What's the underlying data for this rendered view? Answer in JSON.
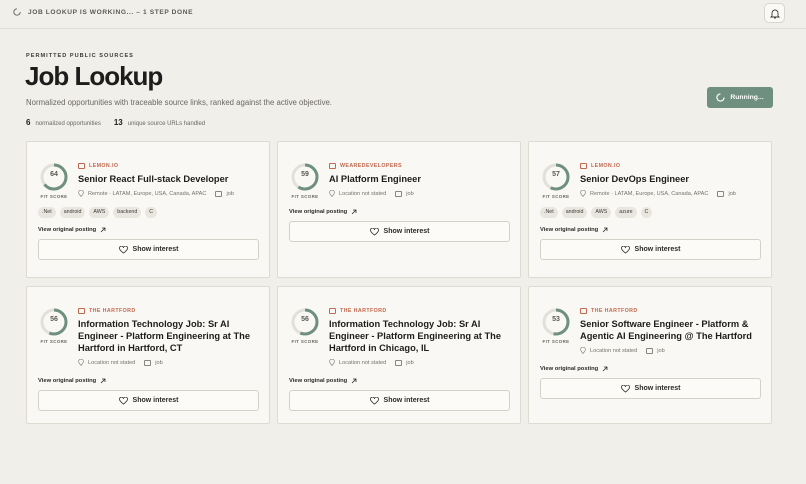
{
  "topbar": {
    "status": "JOB LOOKUP IS WORKING... – 1 STEP DONE"
  },
  "header": {
    "eyebrow": "PERMITTED PUBLIC SOURCES",
    "title": "Job Lookup",
    "subtitle": "Normalized opportunities with traceable source links, ranked against the active objective.",
    "stats": {
      "opps_count": "6",
      "opps_label": "normalized opportunities",
      "urls_count": "13",
      "urls_label": "unique source URLs handled"
    },
    "run_button": "Running..."
  },
  "labels": {
    "fit_score": "FIT SCORE",
    "view_posting": "View original posting",
    "show_interest": "Show interest"
  },
  "colors": {
    "accent": "#6f8f80",
    "source": "#c26a4f",
    "gauge_fill": "#6f8f80",
    "gauge_track": "#e3e0d9"
  },
  "cards": [
    {
      "score": "64",
      "score_value": 64,
      "source": "LEMON.IO",
      "title": "Senior React Full-stack Developer",
      "location": "Remote · LATAM, Europe, USA, Canada, APAC",
      "type": "job",
      "tags": [
        ".Net",
        "android",
        "AWS",
        "backend",
        "C"
      ]
    },
    {
      "score": "59",
      "score_value": 59,
      "source": "WEAREDEVELOPERS",
      "title": "AI Platform Engineer",
      "location": "Location not stated",
      "type": "job",
      "tags": []
    },
    {
      "score": "57",
      "score_value": 57,
      "source": "LEMON.IO",
      "title": "Senior DevOps Engineer",
      "location": "Remote · LATAM, Europe, USA, Canada, APAC",
      "type": "job",
      "tags": [
        ".Net",
        "android",
        "AWS",
        "azure",
        "C"
      ]
    },
    {
      "score": "56",
      "score_value": 56,
      "source": "THE HARTFORD",
      "title": "Information Technology Job: Sr AI Engineer - Platform Engineering at The Hartford in Hartford, CT",
      "location": "Location not stated",
      "type": "job",
      "tags": []
    },
    {
      "score": "56",
      "score_value": 56,
      "source": "THE HARTFORD",
      "title": "Information Technology Job: Sr AI Engineer - Platform Engineering at The Hartford in Chicago, IL",
      "location": "Location not stated",
      "type": "job",
      "tags": []
    },
    {
      "score": "53",
      "score_value": 53,
      "source": "THE HARTFORD",
      "title": "Senior Software Engineer - Platform & Agentic AI Engineering @ The Hartford",
      "location": "Location not stated",
      "type": "job",
      "tags": []
    }
  ]
}
